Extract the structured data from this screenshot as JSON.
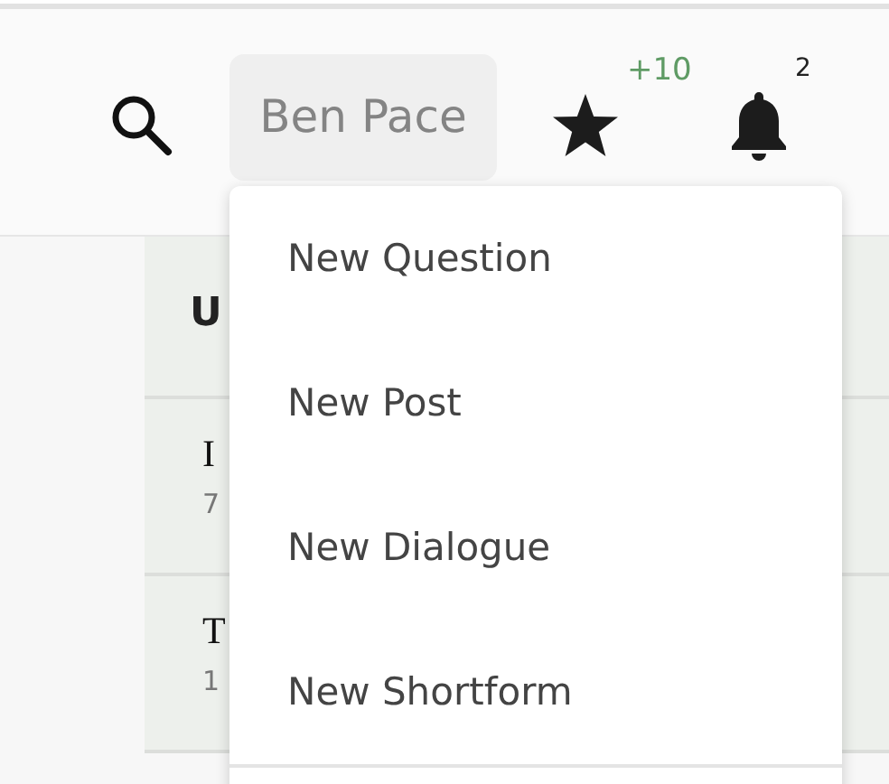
{
  "header": {
    "user_button": "Ben Pace",
    "karma_change": "+10",
    "notification_count": "2"
  },
  "menu": {
    "items": [
      "New Question",
      "New Post",
      "New Dialogue",
      "New Shortform"
    ]
  },
  "content": {
    "section_title": "U",
    "rows": [
      {
        "title": "I",
        "meta": "7"
      },
      {
        "title": "T",
        "meta": "1"
      }
    ]
  }
}
